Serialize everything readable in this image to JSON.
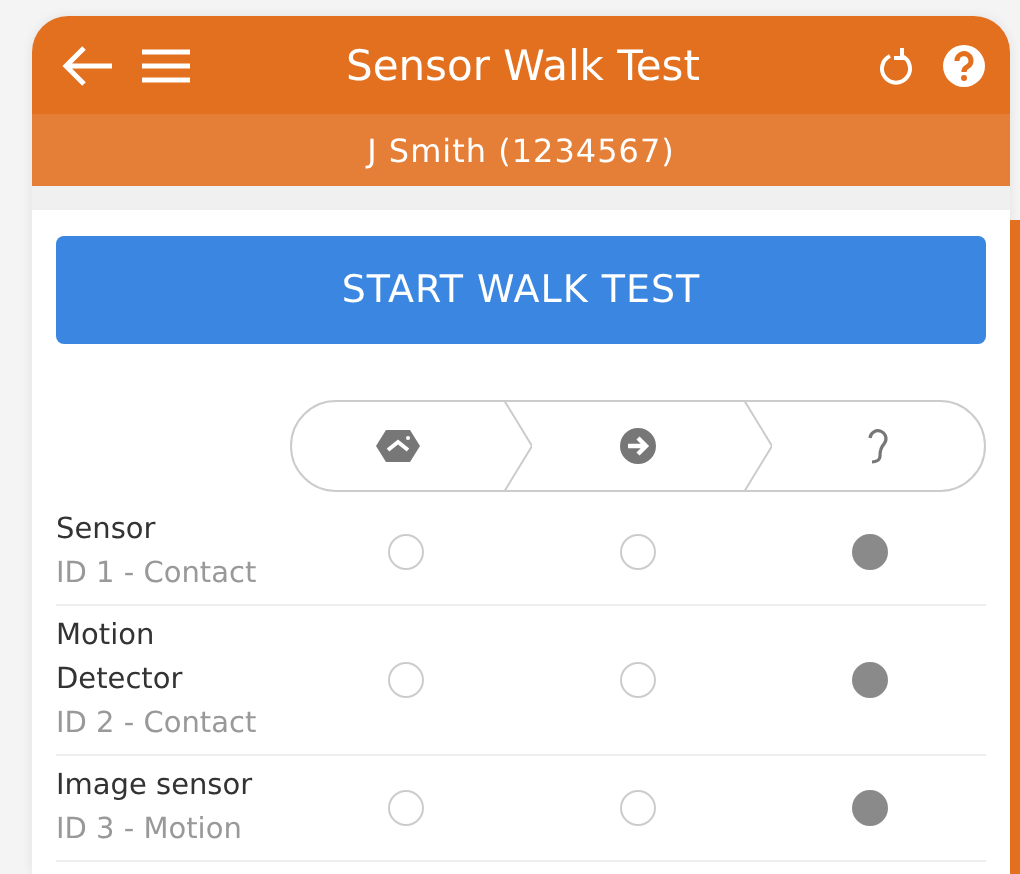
{
  "header": {
    "title": "Sensor Walk Test"
  },
  "subheader": {
    "text": "J Smith (1234567)"
  },
  "start_button": {
    "label": "START WALK TEST"
  },
  "steps": [
    {
      "kind": "home"
    },
    {
      "kind": "arrow"
    },
    {
      "kind": "ear"
    }
  ],
  "sensors": [
    {
      "name": "Sensor",
      "detail": "ID 1 - Contact",
      "options": [
        {
          "selected": false
        },
        {
          "selected": false
        },
        {
          "selected": true
        }
      ]
    },
    {
      "name": "Motion Detector",
      "detail": "ID 2 - Contact",
      "options": [
        {
          "selected": false
        },
        {
          "selected": false
        },
        {
          "selected": true
        }
      ]
    },
    {
      "name": "Image sensor",
      "detail": "ID 3 - Motion",
      "options": [
        {
          "selected": false
        },
        {
          "selected": false
        },
        {
          "selected": true
        }
      ]
    }
  ]
}
